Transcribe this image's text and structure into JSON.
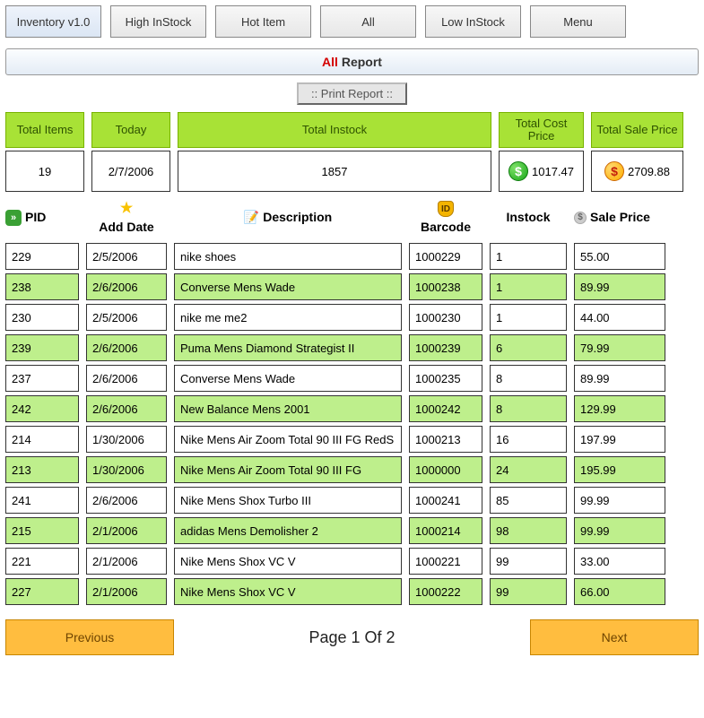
{
  "tabs": {
    "inventory": "Inventory v1.0",
    "high": "High InStock",
    "hot": "Hot Item",
    "all": "All",
    "low": "Low InStock",
    "menu": "Menu"
  },
  "report": {
    "prefix": "All",
    "suffix": "Report"
  },
  "print_label": ":: Print Report ::",
  "summary_heads": {
    "items": "Total Items",
    "today": "Today",
    "instock": "Total Instock",
    "cost": "Total Cost Price",
    "sale": "Total Sale Price"
  },
  "summary_vals": {
    "items": "19",
    "today": "2/7/2006",
    "instock": "1857",
    "cost": "1017.47",
    "sale": "2709.88"
  },
  "columns": {
    "pid": "PID",
    "add": "Add Date",
    "desc": "Description",
    "barcode": "Barcode",
    "instock": "Instock",
    "sale": "Sale Price"
  },
  "rows": [
    {
      "pid": "229",
      "add": "2/5/2006",
      "desc": "nike shoes",
      "bar": "1000229",
      "in": "1",
      "sp": "55.00"
    },
    {
      "pid": "238",
      "add": "2/6/2006",
      "desc": "Converse Mens Wade",
      "bar": "1000238",
      "in": "1",
      "sp": "89.99"
    },
    {
      "pid": "230",
      "add": "2/5/2006",
      "desc": "nike me me2",
      "bar": "1000230",
      "in": "1",
      "sp": "44.00"
    },
    {
      "pid": "239",
      "add": "2/6/2006",
      "desc": "Puma Mens Diamond Strategist II",
      "bar": "1000239",
      "in": "6",
      "sp": "79.99"
    },
    {
      "pid": "237",
      "add": "2/6/2006",
      "desc": "Converse Mens Wade",
      "bar": "1000235",
      "in": "8",
      "sp": "89.99"
    },
    {
      "pid": "242",
      "add": "2/6/2006",
      "desc": "New Balance Mens 2001",
      "bar": "1000242",
      "in": "8",
      "sp": "129.99"
    },
    {
      "pid": "214",
      "add": "1/30/2006",
      "desc": "Nike Mens Air Zoom Total 90 III FG RedS",
      "bar": "1000213",
      "in": "16",
      "sp": "197.99"
    },
    {
      "pid": "213",
      "add": "1/30/2006",
      "desc": "Nike Mens Air Zoom Total 90 III FG",
      "bar": "1000000",
      "in": "24",
      "sp": "195.99"
    },
    {
      "pid": "241",
      "add": "2/6/2006",
      "desc": "Nike Mens Shox Turbo III",
      "bar": "1000241",
      "in": "85",
      "sp": "99.99"
    },
    {
      "pid": "215",
      "add": "2/1/2006",
      "desc": "adidas Mens Demolisher 2",
      "bar": "1000214",
      "in": "98",
      "sp": "99.99"
    },
    {
      "pid": "221",
      "add": "2/1/2006",
      "desc": "Nike Mens Shox VC V",
      "bar": "1000221",
      "in": "99",
      "sp": "33.00"
    },
    {
      "pid": "227",
      "add": "2/1/2006",
      "desc": "Nike Mens Shox VC V",
      "bar": "1000222",
      "in": "99",
      "sp": "66.00"
    }
  ],
  "pager": {
    "prev": "Previous",
    "next": "Next",
    "label": "Page 1 Of 2"
  }
}
